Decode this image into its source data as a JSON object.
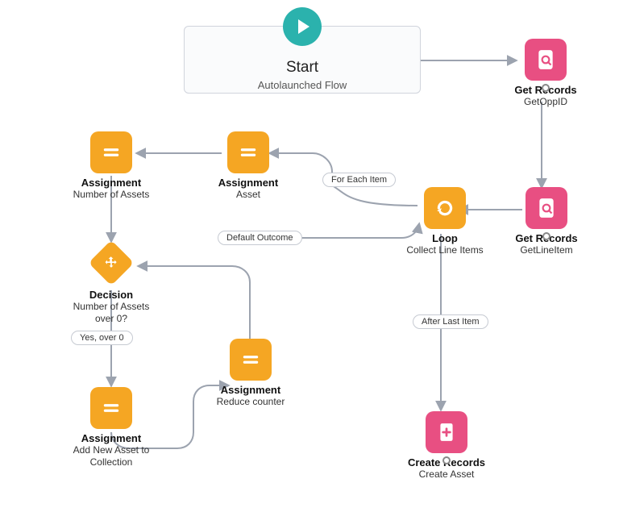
{
  "canvas": {
    "bg": "#ffffff"
  },
  "start": {
    "title": "Start",
    "subtitle": "Autolaunched Flow"
  },
  "nodes": {
    "getOppId": {
      "type": "get",
      "title": "Get Records",
      "sub": "GetOppID"
    },
    "getLineItem": {
      "type": "get",
      "title": "Get Records",
      "sub": "GetLineItem"
    },
    "loop": {
      "type": "loop",
      "title": "Loop",
      "sub": "Collect Line Items"
    },
    "assignAsset": {
      "type": "assign",
      "title": "Assignment",
      "sub": "Asset"
    },
    "assignNumAssets": {
      "type": "assign",
      "title": "Assignment",
      "sub": "Number of Assets"
    },
    "decision": {
      "type": "decision",
      "title": "Decision",
      "sub": "Number of Assets over 0?"
    },
    "assignAddNew": {
      "type": "assign",
      "title": "Assignment",
      "sub": "Add New Asset to Collection"
    },
    "assignReduce": {
      "type": "assign",
      "title": "Assignment",
      "sub": "Reduce counter"
    },
    "createAsset": {
      "type": "create",
      "title": "Create Records",
      "sub": "Create Asset"
    }
  },
  "badges": {
    "forEach": "For Each Item",
    "afterLast": "After Last Item",
    "default": "Default Outcome",
    "yes": "Yes, over 0"
  },
  "colors": {
    "orange": "#f5a623",
    "pink": "#e84f82",
    "teal": "#2bb2ad",
    "arrow": "#9ca3af"
  },
  "chart_data": {
    "type": "flow-diagram",
    "start": {
      "label": "Start",
      "subtype": "Autolaunched Flow"
    },
    "elements": [
      {
        "id": "getOppId",
        "kind": "Get Records",
        "label": "GetOppID"
      },
      {
        "id": "getLineItem",
        "kind": "Get Records",
        "label": "GetLineItem"
      },
      {
        "id": "loop",
        "kind": "Loop",
        "label": "Collect Line Items"
      },
      {
        "id": "assignAsset",
        "kind": "Assignment",
        "label": "Asset"
      },
      {
        "id": "assignNumAssets",
        "kind": "Assignment",
        "label": "Number of Assets"
      },
      {
        "id": "decision",
        "kind": "Decision",
        "label": "Number of Assets over 0?"
      },
      {
        "id": "assignAddNew",
        "kind": "Assignment",
        "label": "Add New Asset to Collection"
      },
      {
        "id": "assignReduce",
        "kind": "Assignment",
        "label": "Reduce counter"
      },
      {
        "id": "createAsset",
        "kind": "Create Records",
        "label": "Create Asset"
      }
    ],
    "edges": [
      {
        "from": "start",
        "to": "getOppId"
      },
      {
        "from": "getOppId",
        "to": "getLineItem"
      },
      {
        "from": "getLineItem",
        "to": "loop"
      },
      {
        "from": "loop",
        "to": "assignAsset",
        "label": "For Each Item"
      },
      {
        "from": "assignAsset",
        "to": "assignNumAssets"
      },
      {
        "from": "assignNumAssets",
        "to": "decision"
      },
      {
        "from": "decision",
        "to": "assignAddNew",
        "label": "Yes, over 0"
      },
      {
        "from": "assignAddNew",
        "to": "assignReduce"
      },
      {
        "from": "assignReduce",
        "to": "decision",
        "label": "Default Outcome"
      },
      {
        "from": "loop",
        "to": "createAsset",
        "label": "After Last Item"
      }
    ]
  }
}
